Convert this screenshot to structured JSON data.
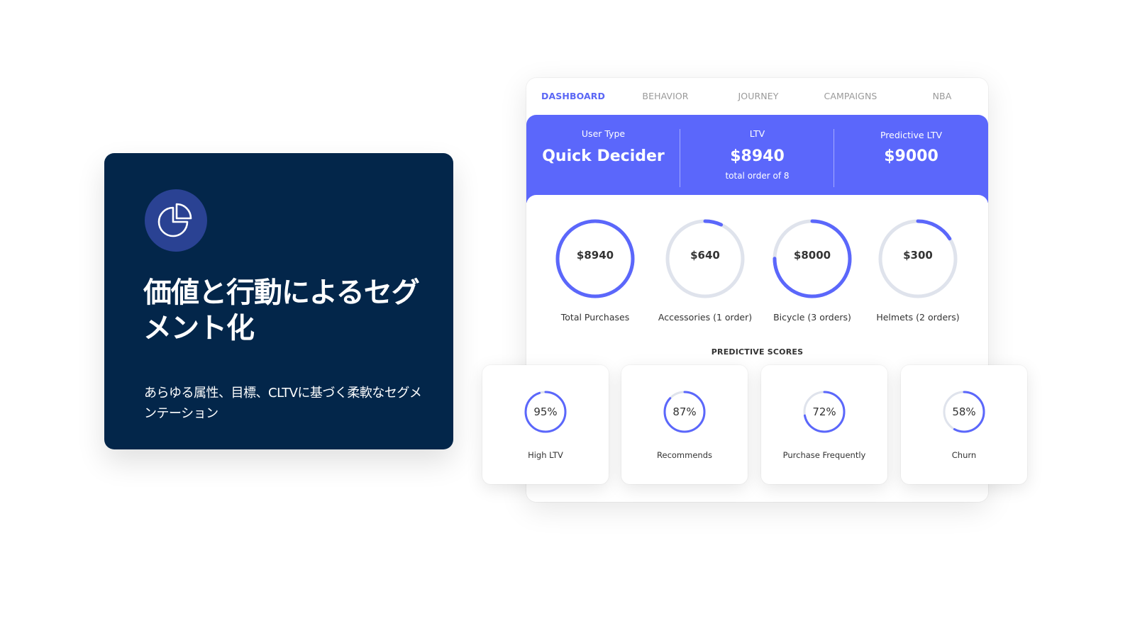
{
  "feature": {
    "icon": "pie-chart-icon",
    "title": "価値と行動によるセグメント化",
    "description": "あらゆる属性、目標、CLTVに基づく柔軟なセグメンテーション"
  },
  "tabs": [
    {
      "label": "DASHBOARD",
      "active": true
    },
    {
      "label": "BEHAVIOR",
      "active": false
    },
    {
      "label": "JOURNEY",
      "active": false
    },
    {
      "label": "CAMPAIGNS",
      "active": false
    },
    {
      "label": "NBA",
      "active": false
    }
  ],
  "summary": {
    "user_type": {
      "label": "User Type",
      "value": "Quick Decider"
    },
    "ltv": {
      "label": "LTV",
      "value": "$8940",
      "sub": "total order of 8"
    },
    "predictive_ltv": {
      "label": "Predictive LTV",
      "value": "$9000"
    }
  },
  "purchases": [
    {
      "value": "$8940",
      "label": "Total Purchases",
      "progress": 1.0
    },
    {
      "value": "$640",
      "label": "Accessories (1 order)",
      "progress": 0.07
    },
    {
      "value": "$8000",
      "label": "Bicycle (3 orders)",
      "progress": 0.75
    },
    {
      "value": "$300",
      "label": "Helmets (2 orders)",
      "progress": 0.16
    }
  ],
  "predictive_scores": {
    "title": "PREDICTIVE SCORES",
    "items": [
      {
        "value": "95%",
        "label": "High LTV",
        "progress": 0.95
      },
      {
        "value": "87%",
        "label": "Recommends",
        "progress": 0.87
      },
      {
        "value": "72%",
        "label": "Purchase Frequently",
        "progress": 0.72
      },
      {
        "value": "58%",
        "label": "Churn",
        "progress": 0.58
      }
    ]
  },
  "colors": {
    "navy": "#03264a",
    "icon_bg": "#2a4293",
    "accent": "#5b67fb",
    "ring_track": "#dfe3ec"
  }
}
